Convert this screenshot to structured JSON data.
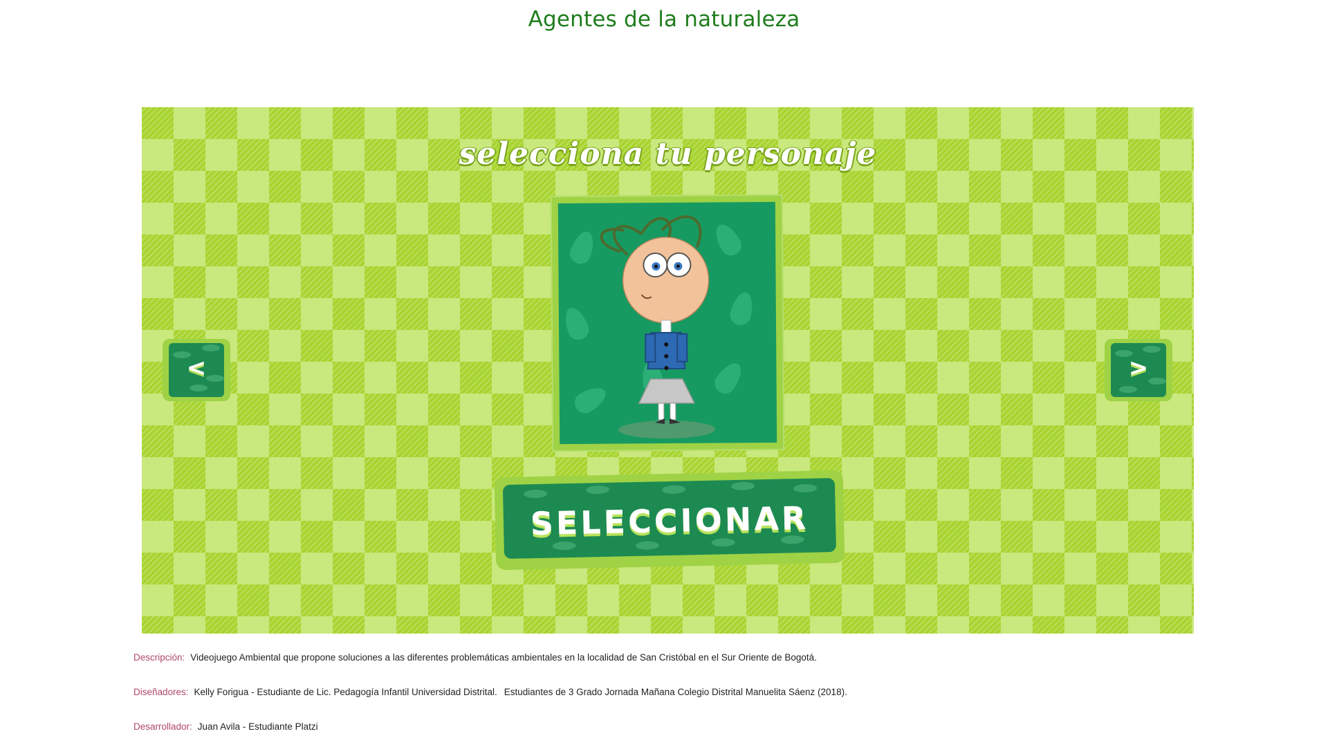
{
  "page": {
    "title": "Agentes de la naturaleza"
  },
  "game": {
    "heading": "selecciona tu personaje",
    "prev_symbol": "<",
    "next_symbol": ">",
    "select_label": "SELECCIONAR"
  },
  "info": {
    "description": {
      "label": "Descripción:",
      "text": "Videojuego Ambiental que propone soluciones a las diferentes problemáticas ambientales en la localidad de San Cristóbal en el Sur Oriente de Bogotá."
    },
    "designers": {
      "label": "Diseñadores:",
      "text_1": "Kelly Forigua - Estudiante de Lic. Pedagogía Infantil Universidad Distrital.",
      "text_2": "Estudiantes de 3 Grado Jornada Mañana Colegio Distrital Manuelita Sáenz (2018)."
    },
    "developer": {
      "label": "Desarrollador:",
      "text": "Juan Avila - Estudiante Platzi"
    }
  },
  "colors": {
    "title": "#1e7d1c",
    "label": "#b0476a",
    "game_green": "#a8d42f",
    "button_green": "#1d8a52"
  }
}
